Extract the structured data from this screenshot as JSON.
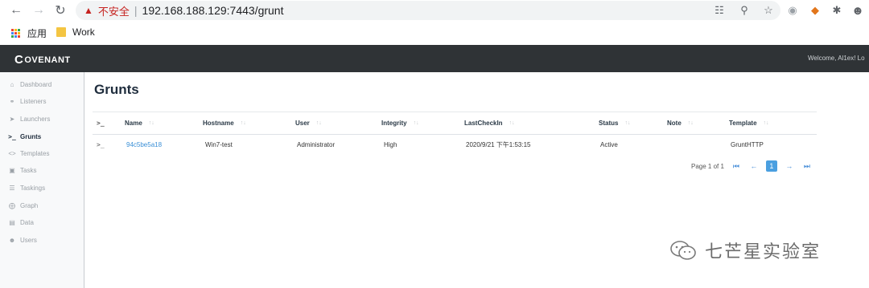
{
  "browser": {
    "security_label": "不安全",
    "url": "192.168.188.129:7443/grunt",
    "bookmarks": [
      {
        "label": "应用"
      },
      {
        "label": "Work"
      }
    ]
  },
  "app": {
    "logo_text": "OVENANT",
    "logo_letter": "C",
    "welcome": "Welcome, Al1ex!  Lo"
  },
  "sidebar": {
    "items": [
      {
        "label": "Dashboard",
        "icon": "home-icon"
      },
      {
        "label": "Listeners",
        "icon": "headphones-icon"
      },
      {
        "label": "Launchers",
        "icon": "rocket-icon"
      },
      {
        "label": "Grunts",
        "icon": "terminal-icon",
        "active": true
      },
      {
        "label": "Templates",
        "icon": "code-icon"
      },
      {
        "label": "Tasks",
        "icon": "cube-icon"
      },
      {
        "label": "Taskings",
        "icon": "layers-icon"
      },
      {
        "label": "Graph",
        "icon": "share-icon"
      },
      {
        "label": "Data",
        "icon": "database-icon"
      },
      {
        "label": "Users",
        "icon": "users-icon"
      }
    ]
  },
  "main": {
    "title": "Grunts",
    "table": {
      "columns": [
        "Name",
        "Hostname",
        "User",
        "Integrity",
        "LastCheckIn",
        "Status",
        "Note",
        "Template"
      ],
      "rows": [
        {
          "name": "94c5be5a18",
          "hostname": "Win7-test",
          "user": "Administrator",
          "integrity": "High",
          "lastcheckin": "2020/9/21 下午1:53:15",
          "status": "Active",
          "note": "",
          "template": "GruntHTTP"
        }
      ]
    },
    "pagination": {
      "text": "Page 1 of 1",
      "current": "1"
    }
  },
  "watermark": "七芒星实验室"
}
